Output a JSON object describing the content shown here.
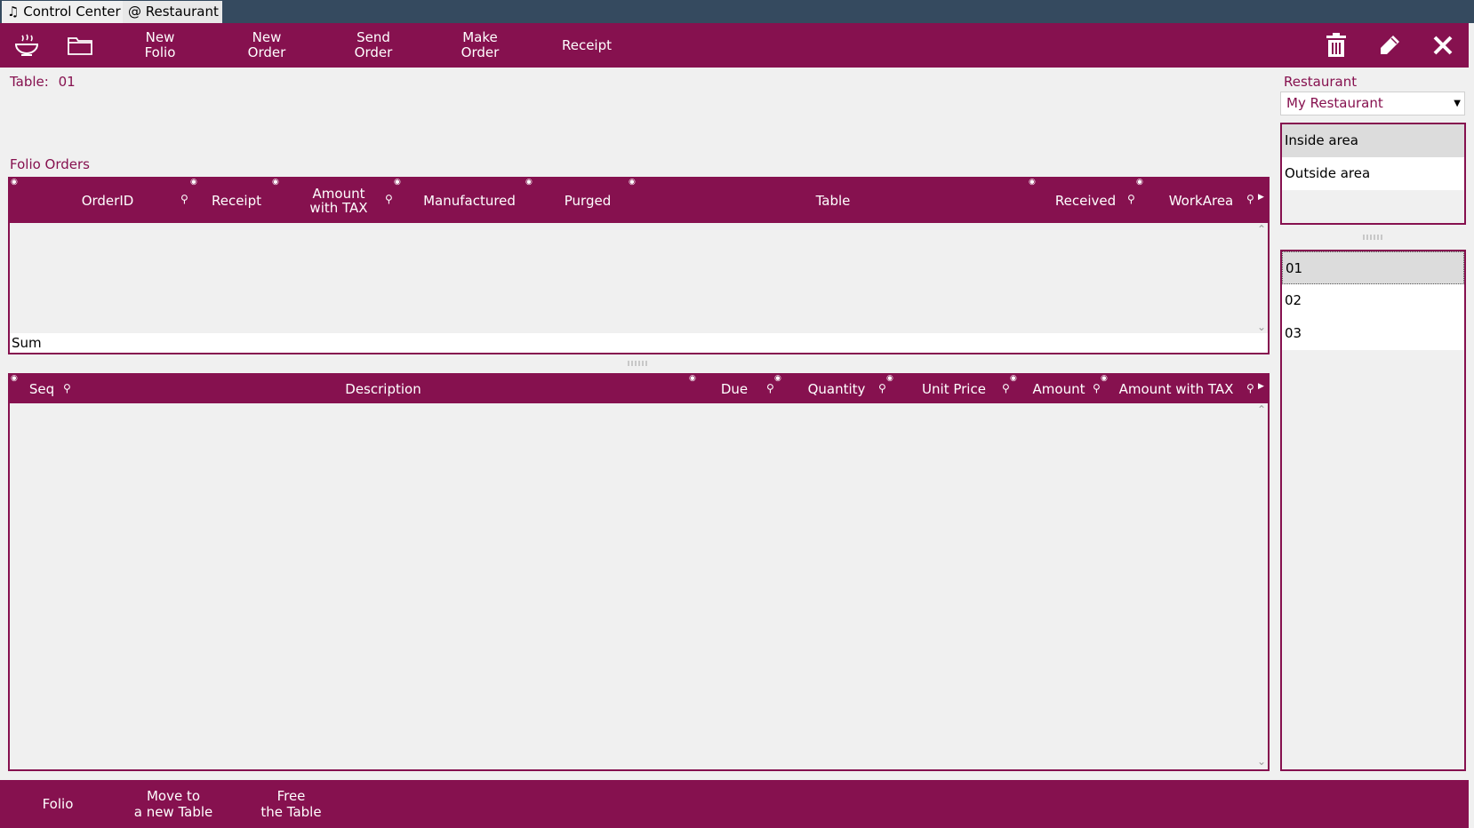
{
  "tabs": [
    {
      "label": "♫ Control Center"
    },
    {
      "label": "@ Restaurant"
    }
  ],
  "toolbar": {
    "icons": [
      "bowl-icon",
      "folder-icon"
    ],
    "buttons": [
      {
        "label": "New\nFolio"
      },
      {
        "label": "New\nOrder"
      },
      {
        "label": "Send\nOrder"
      },
      {
        "label": "Make\nOrder"
      },
      {
        "label": "Receipt"
      }
    ],
    "right_icons": [
      "trash-icon",
      "pencil-icon",
      "close-icon"
    ]
  },
  "table_info": {
    "label": "Table:",
    "value": "01"
  },
  "folio_orders": {
    "title": "Folio Orders",
    "columns": [
      {
        "label": "OrderID"
      },
      {
        "label": "Receipt"
      },
      {
        "label": "Amount\nwith TAX"
      },
      {
        "label": "Manufactured"
      },
      {
        "label": "Purged"
      },
      {
        "label": "Table"
      },
      {
        "label": "Received"
      },
      {
        "label": "WorkArea"
      }
    ],
    "rows": [],
    "sum_label": "Sum"
  },
  "order_items": {
    "columns": [
      {
        "label": "Seq"
      },
      {
        "label": "Description"
      },
      {
        "label": "Due"
      },
      {
        "label": "Quantity"
      },
      {
        "label": "Unit Price"
      },
      {
        "label": "Amount"
      },
      {
        "label": "Amount with TAX"
      }
    ],
    "rows": []
  },
  "sidebar": {
    "restaurant_label": "Restaurant",
    "restaurant_selected": "My Restaurant",
    "areas": [
      {
        "label": "Inside area",
        "selected": true
      },
      {
        "label": "Outside area",
        "selected": false
      }
    ],
    "tables": [
      {
        "label": "01",
        "selected": true
      },
      {
        "label": "02",
        "selected": false
      },
      {
        "label": "03",
        "selected": false
      }
    ]
  },
  "bottom": {
    "buttons": [
      {
        "label": "Folio"
      },
      {
        "label": "Move to\na new Table"
      },
      {
        "label": "Free\nthe Table"
      }
    ]
  },
  "colors": {
    "accent": "#86114f",
    "tabbar": "#354a5f",
    "background": "#f0f0f0"
  }
}
